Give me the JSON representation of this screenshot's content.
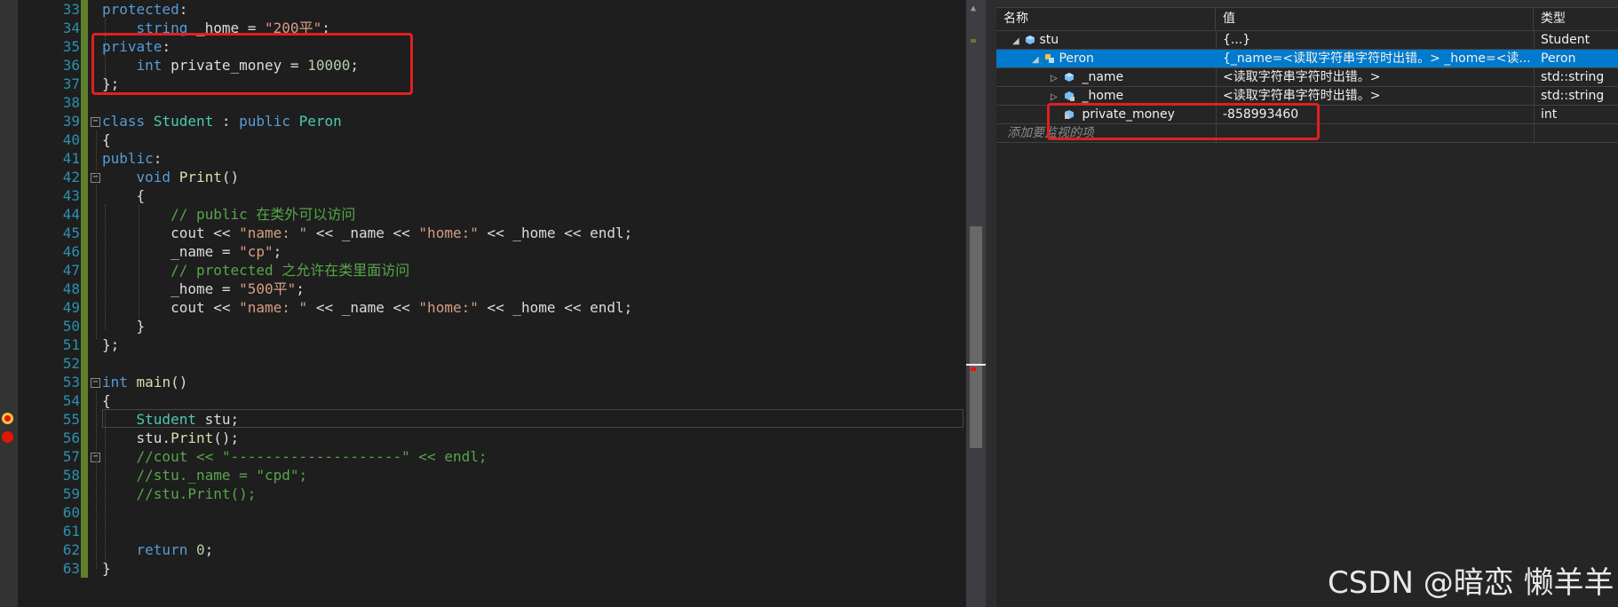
{
  "editor": {
    "line_numbers": [
      "33",
      "34",
      "35",
      "36",
      "37",
      "38",
      "39",
      "40",
      "41",
      "42",
      "43",
      "44",
      "45",
      "46",
      "47",
      "48",
      "49",
      "50",
      "51",
      "52",
      "53",
      "54",
      "55",
      "56",
      "57",
      "58",
      "59",
      "60",
      "61",
      "62",
      "63"
    ],
    "lines": [
      [
        [
          "kw",
          "protected"
        ],
        [
          "id",
          ":"
        ]
      ],
      [
        [
          "id",
          "    "
        ],
        [
          "kw",
          "string"
        ],
        [
          "id",
          " _home = "
        ],
        [
          "st",
          "\"200平\""
        ],
        [
          "id",
          ";"
        ]
      ],
      [
        [
          "kw",
          "private"
        ],
        [
          "id",
          ":"
        ]
      ],
      [
        [
          "id",
          "    "
        ],
        [
          "kw",
          "int"
        ],
        [
          "id",
          " private_money = "
        ],
        [
          "nu",
          "10000"
        ],
        [
          "id",
          ";"
        ]
      ],
      [
        [
          "id",
          "};"
        ]
      ],
      [],
      [
        [
          "kw",
          "class"
        ],
        [
          "id",
          " "
        ],
        [
          "ty",
          "Student"
        ],
        [
          "id",
          " : "
        ],
        [
          "kw",
          "public"
        ],
        [
          "id",
          " "
        ],
        [
          "ty",
          "Peron"
        ]
      ],
      [
        [
          "id",
          "{"
        ]
      ],
      [
        [
          "kw",
          "public"
        ],
        [
          "id",
          ":"
        ]
      ],
      [
        [
          "id",
          "    "
        ],
        [
          "kw",
          "void"
        ],
        [
          "id",
          " "
        ],
        [
          "fn",
          "Print"
        ],
        [
          "id",
          "()"
        ]
      ],
      [
        [
          "id",
          "    {"
        ]
      ],
      [
        [
          "id",
          "        "
        ],
        [
          "cm",
          "// public 在类外可以访问"
        ]
      ],
      [
        [
          "id",
          "        cout << "
        ],
        [
          "st",
          "\"name: \""
        ],
        [
          "id",
          " << _name << "
        ],
        [
          "st",
          "\"home:\""
        ],
        [
          "id",
          " << _home << endl;"
        ]
      ],
      [
        [
          "id",
          "        _name = "
        ],
        [
          "st",
          "\"cp\""
        ],
        [
          "id",
          ";"
        ]
      ],
      [
        [
          "id",
          "        "
        ],
        [
          "cm",
          "// protected 之允许在类里面访问"
        ]
      ],
      [
        [
          "id",
          "        _home = "
        ],
        [
          "st",
          "\"500平\""
        ],
        [
          "id",
          ";"
        ]
      ],
      [
        [
          "id",
          "        cout << "
        ],
        [
          "st",
          "\"name: \""
        ],
        [
          "id",
          " << _name << "
        ],
        [
          "st",
          "\"home:\""
        ],
        [
          "id",
          " << _home << endl;"
        ]
      ],
      [
        [
          "id",
          "    }"
        ]
      ],
      [
        [
          "id",
          "};"
        ]
      ],
      [],
      [
        [
          "kw",
          "int"
        ],
        [
          "id",
          " "
        ],
        [
          "fn",
          "main"
        ],
        [
          "id",
          "()"
        ]
      ],
      [
        [
          "id",
          "{"
        ]
      ],
      [
        [
          "id",
          "    "
        ],
        [
          "ty",
          "Student"
        ],
        [
          "id",
          " stu;"
        ]
      ],
      [
        [
          "id",
          "    stu."
        ],
        [
          "fn",
          "Print"
        ],
        [
          "id",
          "();"
        ]
      ],
      [
        [
          "id",
          "    "
        ],
        [
          "cm",
          "//cout << \"--------------------\" << endl;"
        ]
      ],
      [
        [
          "id",
          "    "
        ],
        [
          "cm",
          "//stu._name = \"cpd\";"
        ]
      ],
      [
        [
          "id",
          "    "
        ],
        [
          "cm",
          "//stu.Print();"
        ]
      ],
      [],
      [],
      [
        [
          "id",
          "    "
        ],
        [
          "kw",
          "return"
        ],
        [
          "id",
          " "
        ],
        [
          "nu",
          "0"
        ],
        [
          "id",
          ";"
        ]
      ],
      [
        [
          "id",
          "}"
        ]
      ]
    ]
  },
  "watch": {
    "headers": {
      "name": "名称",
      "value": "值",
      "type": "类型"
    },
    "rows": [
      {
        "name": "stu",
        "value": "{...}",
        "type": "Student"
      },
      {
        "name": "Peron",
        "value": "{_name=<读取字符串字符时出错。> _home=<读...",
        "type": "Peron"
      },
      {
        "name": "_name",
        "value": "<读取字符串字符时出错。>",
        "type": "std::string"
      },
      {
        "name": "_home",
        "value": "<读取字符串字符时出错。>",
        "type": "std::string"
      },
      {
        "name": "private_money",
        "value": "-858993460",
        "type": "int"
      }
    ],
    "add_placeholder": "添加要监视的项"
  },
  "watermark": "CSDN @暗恋 懒羊羊",
  "colors": {
    "keyword": "#569cd6",
    "type": "#4ec9b0",
    "function": "#dcdcaa",
    "string": "#d69d85",
    "comment": "#57a64a",
    "number": "#b5cea8",
    "line_number": "#2b91af",
    "selection": "#007acc",
    "highlight_box": "#e02020",
    "breakpoint": "#e51400"
  }
}
